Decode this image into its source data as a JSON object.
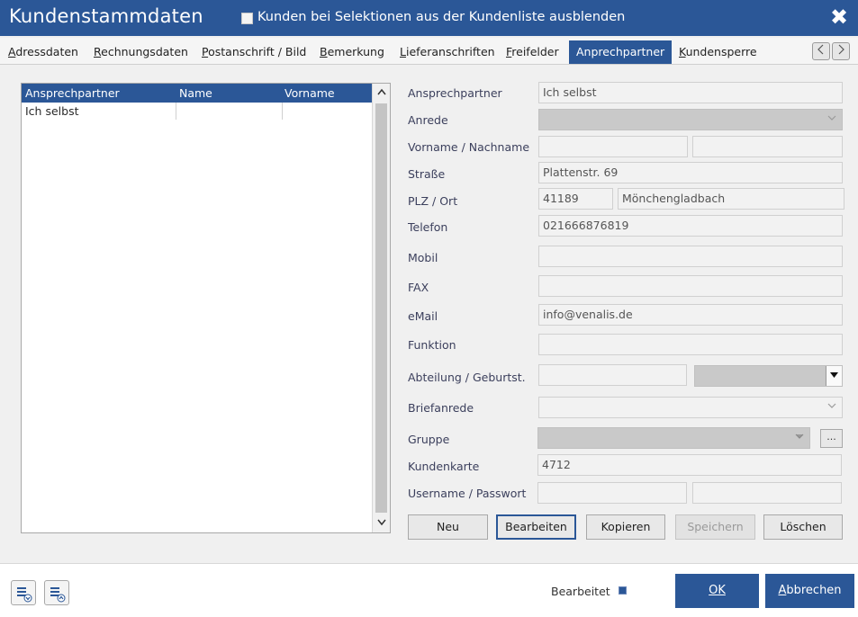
{
  "window": {
    "title": "Kundenstammdaten",
    "hide_checkbox_label": "Kunden bei Selektionen aus der Kundenliste ausblenden",
    "close_glyph": "✖",
    "accent_color": "#2b5797"
  },
  "tabs": [
    {
      "first": "A",
      "rest": "dressdaten"
    },
    {
      "first": "R",
      "rest": "echnungsdaten"
    },
    {
      "first": "P",
      "rest": "ostanschrift / Bild"
    },
    {
      "first": "B",
      "rest": "emerkung"
    },
    {
      "first": "L",
      "rest": "ieferanschriften"
    },
    {
      "first": "F",
      "rest": "reifelder"
    },
    {
      "first": "",
      "rest": "Anprechpartner"
    },
    {
      "first": "K",
      "rest": "undensperre"
    }
  ],
  "tab_nav": {
    "prev_icon": "arrow-left-icon",
    "next_icon": "arrow-right-icon"
  },
  "list": {
    "columns": [
      "Ansprechpartner",
      "Name",
      "Vorname"
    ],
    "rows": [
      {
        "ansprechpartner": "Ich selbst",
        "name": "",
        "vorname": ""
      }
    ]
  },
  "form": {
    "ansprechpartner": {
      "label": "Ansprechpartner",
      "value": "Ich selbst"
    },
    "anrede": {
      "label": "Anrede",
      "value": ""
    },
    "vorname_nachname": {
      "label": "Vorname / Nachname",
      "vorname": "",
      "nachname": ""
    },
    "strasse": {
      "label": "Straße",
      "value": "Plattenstr. 69"
    },
    "plz_ort": {
      "label": "PLZ / Ort",
      "plz": "41189",
      "ort": "Mönchengladbach"
    },
    "telefon": {
      "label": "Telefon",
      "value": "021666876819"
    },
    "mobil": {
      "label": "Mobil",
      "value": ""
    },
    "fax": {
      "label": "FAX",
      "value": ""
    },
    "email": {
      "label": "eMail",
      "value": "info@venalis.de"
    },
    "funktion": {
      "label": "Funktion",
      "value": ""
    },
    "abteilung_geburtstag": {
      "label": "Abteilung / Geburtst.",
      "abteilung": "",
      "geburtstag": ""
    },
    "briefanrede": {
      "label": "Briefanrede",
      "value": ""
    },
    "gruppe": {
      "label": "Gruppe",
      "value": "",
      "button": "..."
    },
    "kundenkarte": {
      "label": "Kundenkarte",
      "value": "4712"
    },
    "username_passwort": {
      "label": "Username / Passwort",
      "username": "",
      "passwort": ""
    }
  },
  "buttons": {
    "neu": "Neu",
    "bearbeiten": "Bearbeiten",
    "kopieren": "Kopieren",
    "speichern": "Speichern",
    "loeschen": "Löschen"
  },
  "footer": {
    "edited_label": "Bearbeitet",
    "ok_label": "OK",
    "cancel_first": "A",
    "cancel_rest": "bbrechen"
  }
}
